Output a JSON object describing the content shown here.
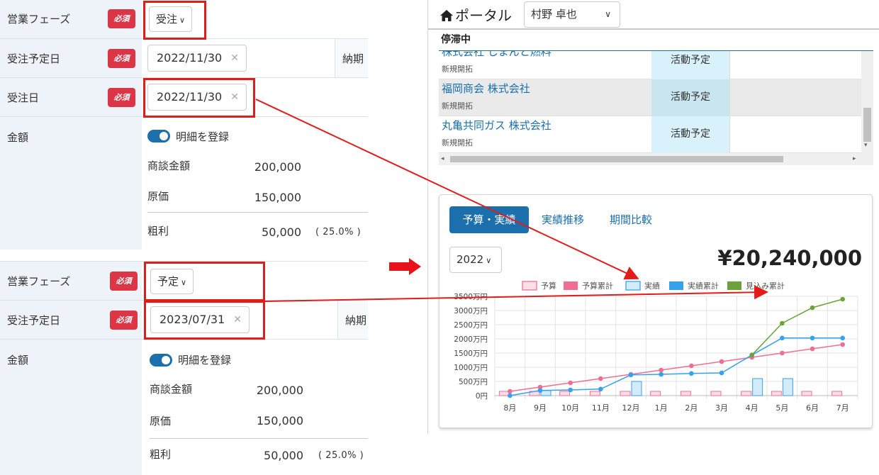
{
  "form_top": {
    "phase_label": "営業フェーズ",
    "required": "必須",
    "phase_value": "受注",
    "expected_date_label": "受注予定日",
    "expected_date": "2022/11/30",
    "due_label": "納期",
    "order_date_label": "受注日",
    "order_date": "2022/11/30",
    "amount_label": "金額",
    "detail_toggle_label": "明細を登録",
    "deal_amount_label": "商談金額",
    "deal_amount": "200,000",
    "cost_label": "原価",
    "cost": "150,000",
    "gross_label": "粗利",
    "gross": "50,000",
    "gross_pct": "( 25.0% )"
  },
  "form_bottom": {
    "phase_label": "営業フェーズ",
    "required": "必須",
    "phase_value": "予定",
    "expected_date_label": "受注予定日",
    "expected_date": "2023/07/31",
    "due_label": "納期",
    "amount_label": "金額",
    "detail_toggle_label": "明細を登録",
    "deal_amount_label": "商談金額",
    "deal_amount": "200,000",
    "cost_label": "原価",
    "cost": "150,000",
    "gross_label": "粗利",
    "gross": "50,000",
    "gross_pct": "( 25.0% )"
  },
  "portal": {
    "title": "ポータル",
    "user": "村野 卓也",
    "section": "停滞中",
    "rows": [
      {
        "name": "株式会社 しまんと燃料",
        "sub": "新規開拓",
        "status": "活動予定"
      },
      {
        "name": "福岡商会 株式会社",
        "sub": "新規開拓",
        "status": "活動予定"
      },
      {
        "name": "丸亀共同ガス 株式会社",
        "sub": "新規開拓",
        "status": "活動予定"
      }
    ]
  },
  "card": {
    "tabs": [
      "予算・実績",
      "実績推移",
      "期間比較"
    ],
    "year": "2022",
    "total": "¥20,240,000"
  },
  "colors": {
    "accent": "#1b6fad",
    "required": "#dc3545",
    "highlight": "#e21b1b",
    "budget": "#f06e93",
    "actual": "#36a2eb",
    "forecast": "#6ba33a"
  },
  "chart_data": {
    "type": "bar",
    "categories": [
      "8月",
      "9月",
      "10月",
      "11月",
      "12月",
      "1月",
      "2月",
      "3月",
      "4月",
      "5月",
      "6月",
      "7月"
    ],
    "yticks": [
      "0円",
      "500万円",
      "1000万円",
      "1500万円",
      "2000万円",
      "2500万円",
      "3000万円",
      "3500万円"
    ],
    "ylim": [
      0,
      3500
    ],
    "series": [
      {
        "name": "予算",
        "kind": "bar",
        "values": [
          150,
          150,
          150,
          150,
          150,
          150,
          150,
          150,
          150,
          150,
          150,
          150
        ]
      },
      {
        "name": "予算累計",
        "kind": "line",
        "values": [
          150,
          300,
          450,
          600,
          750,
          900,
          1050,
          1200,
          1350,
          1500,
          1650,
          1800
        ]
      },
      {
        "name": "実績",
        "kind": "bar",
        "values": [
          0,
          180,
          0,
          0,
          500,
          0,
          0,
          0,
          600,
          600,
          0,
          0
        ]
      },
      {
        "name": "実績累計",
        "kind": "line",
        "values": [
          0,
          180,
          200,
          230,
          730,
          750,
          780,
          800,
          1430,
          2030,
          2030,
          2030
        ]
      },
      {
        "name": "見込み累計",
        "kind": "line",
        "values": [
          null,
          null,
          null,
          null,
          null,
          null,
          null,
          null,
          1430,
          2550,
          3100,
          3400
        ]
      }
    ],
    "legend_position": "top",
    "grid": true
  }
}
